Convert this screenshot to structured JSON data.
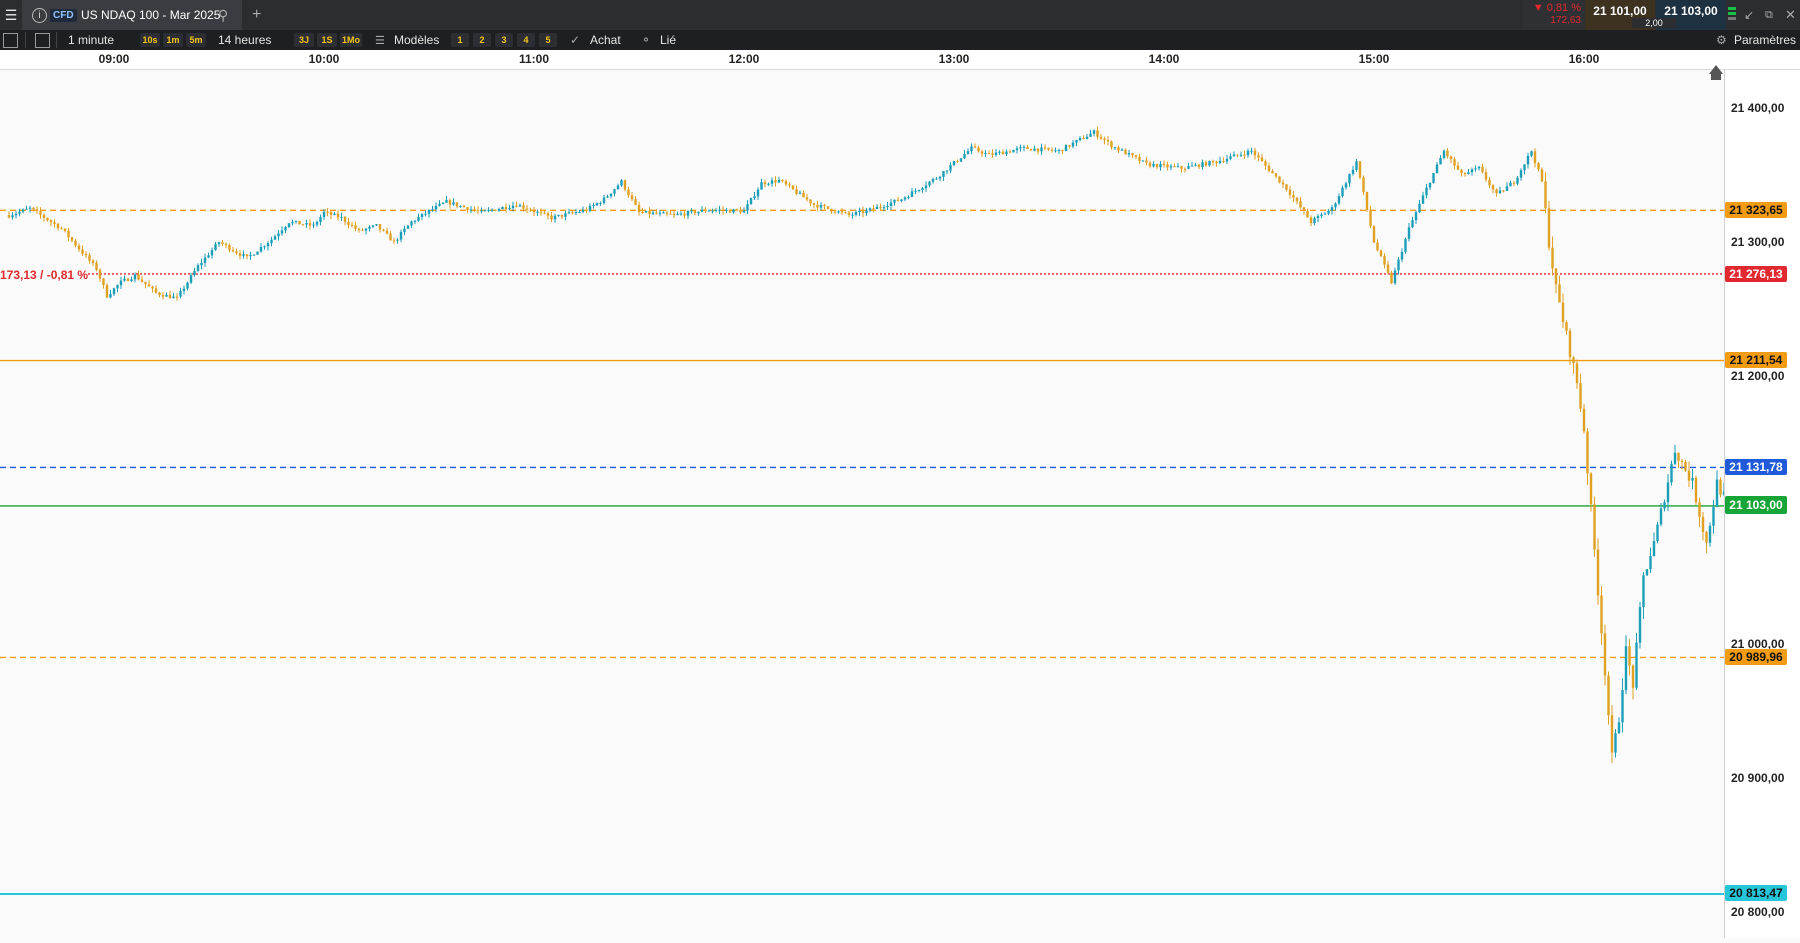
{
  "window": {
    "tab_type": "CFD",
    "instrument": "US NDAQ 100 - Mar 2025",
    "change_pct": "▼ 0,81 %",
    "change_abs": "172,63",
    "bid": "21 101,00",
    "ask": "21 103,00",
    "spread": "2,00"
  },
  "toolbar": {
    "interval": "1 minute",
    "quick_intervals": [
      "10s",
      "1m",
      "5m"
    ],
    "range": "14 heures",
    "quick_ranges": [
      "3J",
      "1S",
      "1Mo"
    ],
    "templates_label": "Modèles",
    "layouts": [
      "1",
      "2",
      "3",
      "4",
      "5"
    ],
    "buy_label": "Achat",
    "link_label": "Lié",
    "settings_label": "Paramètres"
  },
  "colors": {
    "up": "#1b9fb8",
    "down": "#e0a020",
    "orange": "#f39c12",
    "red": "#e0282e",
    "blue": "#1f5ad8",
    "green": "#18a538",
    "cyan": "#26c6da"
  },
  "chart_data": {
    "type": "candlestick",
    "x_axis_ticks": [
      "09:00",
      "10:00",
      "11:00",
      "12:00",
      "13:00",
      "14:00",
      "15:00",
      "16:00"
    ],
    "y_axis_ticks": [
      "21 400,00",
      "21 300,00",
      "21 200,00",
      "21 000,00",
      "20 900,00",
      "20 800,00"
    ],
    "ylim": [
      20780,
      21430
    ],
    "change_label": "173,13 / -0,81 %",
    "horizontal_lines": [
      {
        "price": 21323.65,
        "label": "21 323,65",
        "style": "dashed",
        "color": "orange"
      },
      {
        "price": 21276.13,
        "label": "21 276,13",
        "style": "dotted",
        "color": "red"
      },
      {
        "price": 21211.54,
        "label": "21 211,54",
        "style": "solid",
        "color": "orange"
      },
      {
        "price": 21131.78,
        "label": "21 131,78",
        "style": "dashed",
        "color": "blue"
      },
      {
        "price": 21103.0,
        "label": "21 103,00",
        "style": "solid",
        "color": "green"
      },
      {
        "price": 20989.96,
        "label": "20 989,96",
        "style": "dashed",
        "color": "orange"
      },
      {
        "price": 20813.47,
        "label": "20 813,47",
        "style": "solid",
        "color": "cyan"
      }
    ],
    "price_path": [
      [
        "08:30",
        21320
      ],
      [
        "08:36",
        21325
      ],
      [
        "08:45",
        21310
      ],
      [
        "08:50",
        21295
      ],
      [
        "08:55",
        21280
      ],
      [
        "08:58",
        21260
      ],
      [
        "09:02",
        21270
      ],
      [
        "09:06",
        21275
      ],
      [
        "09:12",
        21262
      ],
      [
        "09:18",
        21258
      ],
      [
        "09:24",
        21282
      ],
      [
        "09:30",
        21300
      ],
      [
        "09:38",
        21288
      ],
      [
        "09:45",
        21302
      ],
      [
        "09:50",
        21315
      ],
      [
        "09:57",
        21312
      ],
      [
        "10:00",
        21322
      ],
      [
        "10:05",
        21318
      ],
      [
        "10:10",
        21308
      ],
      [
        "10:15",
        21312
      ],
      [
        "10:20",
        21300
      ],
      [
        "10:25",
        21315
      ],
      [
        "10:30",
        21323
      ],
      [
        "10:35",
        21330
      ],
      [
        "10:45",
        21322
      ],
      [
        "10:55",
        21328
      ],
      [
        "11:05",
        21318
      ],
      [
        "11:15",
        21324
      ],
      [
        "11:20",
        21332
      ],
      [
        "11:25",
        21345
      ],
      [
        "11:30",
        21322
      ],
      [
        "11:40",
        21320
      ],
      [
        "11:50",
        21324
      ],
      [
        "12:00",
        21323
      ],
      [
        "12:05",
        21344
      ],
      [
        "12:10",
        21346
      ],
      [
        "12:20",
        21328
      ],
      [
        "12:30",
        21320
      ],
      [
        "12:35",
        21323
      ],
      [
        "12:45",
        21332
      ],
      [
        "12:55",
        21348
      ],
      [
        "13:05",
        21370
      ],
      [
        "13:10",
        21365
      ],
      [
        "13:20",
        21370
      ],
      [
        "13:30",
        21368
      ],
      [
        "13:40",
        21382
      ],
      [
        "13:45",
        21372
      ],
      [
        "13:55",
        21358
      ],
      [
        "14:05",
        21355
      ],
      [
        "14:15",
        21360
      ],
      [
        "14:25",
        21368
      ],
      [
        "14:30",
        21354
      ],
      [
        "14:35",
        21340
      ],
      [
        "14:42",
        21315
      ],
      [
        "14:48",
        21325
      ],
      [
        "14:55",
        21360
      ],
      [
        "15:00",
        21300
      ],
      [
        "15:05",
        21270
      ],
      [
        "15:10",
        21310
      ],
      [
        "15:15",
        21340
      ],
      [
        "15:20",
        21368
      ],
      [
        "15:25",
        21350
      ],
      [
        "15:30",
        21355
      ],
      [
        "15:35",
        21335
      ],
      [
        "15:40",
        21345
      ],
      [
        "15:45",
        21368
      ],
      [
        "15:48",
        21345
      ],
      [
        "15:50",
        21300
      ],
      [
        "15:52",
        21265
      ],
      [
        "15:55",
        21230
      ],
      [
        "15:58",
        21195
      ],
      [
        "16:00",
        21160
      ],
      [
        "16:02",
        21100
      ],
      [
        "16:04",
        21040
      ],
      [
        "16:06",
        20980
      ],
      [
        "16:08",
        20915
      ],
      [
        "16:10",
        20945
      ],
      [
        "16:12",
        20995
      ],
      [
        "16:14",
        20970
      ],
      [
        "16:17",
        21050
      ],
      [
        "16:20",
        21075
      ],
      [
        "16:23",
        21110
      ],
      [
        "16:26",
        21145
      ],
      [
        "16:29",
        21130
      ],
      [
        "16:31",
        21120
      ],
      [
        "16:35",
        21075
      ],
      [
        "16:38",
        21120
      ],
      [
        "16:40",
        21110
      ],
      [
        "16:42",
        21103
      ]
    ]
  }
}
